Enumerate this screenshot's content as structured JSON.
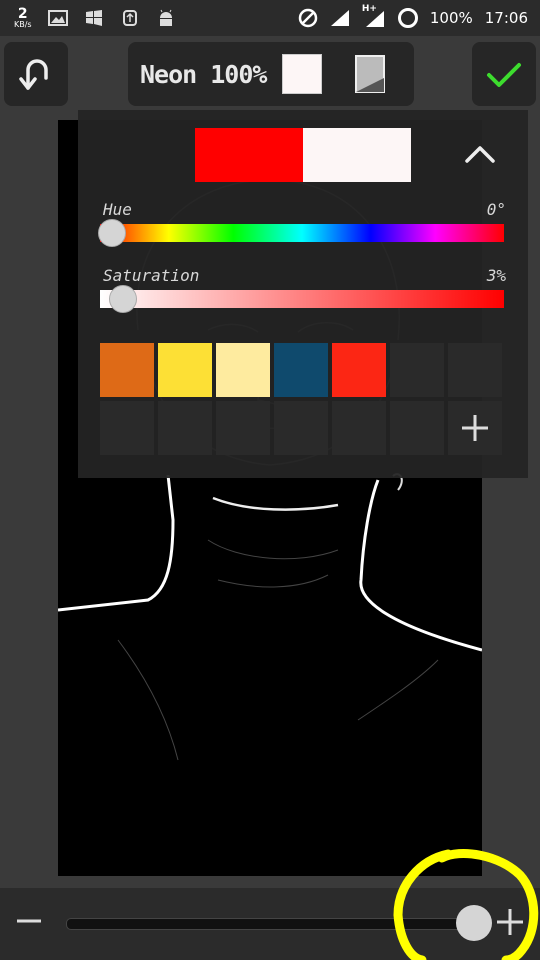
{
  "status_bar": {
    "network_speed_value": "2",
    "network_speed_unit": "KB/s",
    "network_type": "H+",
    "battery": "100%",
    "time": "17:06"
  },
  "toolbar": {
    "effect_title": "Neon 100%",
    "selected_color": "#fdf6f6"
  },
  "color_panel": {
    "previous_color": "#ff0000",
    "current_color": "#fdf6f6",
    "hue": {
      "label": "Hue",
      "value_text": "0°",
      "value_fraction": 0.0
    },
    "saturation": {
      "label": "Saturation",
      "value_text": "3%",
      "value_fraction": 0.03
    },
    "saved_colors": [
      "#de6a17",
      "#fde035",
      "#feeb9f",
      "#0f4a6d",
      "#fc2614"
    ],
    "empty_slot_color": "#2a2a2a",
    "add_color_icon": "plus-icon"
  },
  "bottom_slider": {
    "value_fraction": 0.93,
    "decrease_icon": "minus-icon",
    "increase_icon": "plus-icon"
  },
  "colors": {
    "accent_check": "#3ddc2e",
    "annotation": "#ffff00"
  }
}
